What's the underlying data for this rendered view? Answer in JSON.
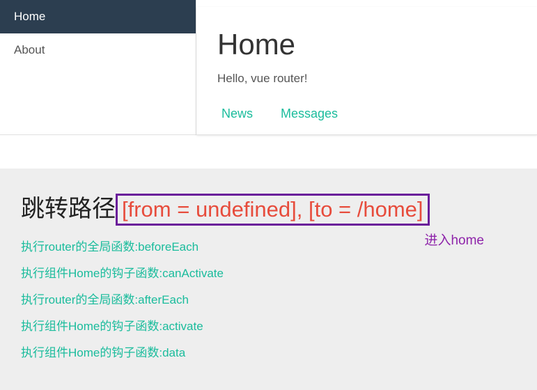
{
  "sidebar": {
    "items": [
      {
        "label": "Home",
        "active": true
      },
      {
        "label": "About",
        "active": false
      }
    ]
  },
  "main": {
    "title": "Home",
    "greeting": "Hello, vue router!",
    "tabs": [
      {
        "label": "News"
      },
      {
        "label": "Messages"
      }
    ]
  },
  "bottom": {
    "heading": "跳转路径",
    "route_info": "[from = undefined], [to = /home]",
    "enter_label": "进入home",
    "logs": [
      "执行router的全局函数:beforeEach",
      "执行组件Home的钩子函数:canActivate",
      "执行router的全局函数:afterEach",
      "执行组件Home的钩子函数:activate",
      "执行组件Home的钩子函数:data"
    ]
  }
}
